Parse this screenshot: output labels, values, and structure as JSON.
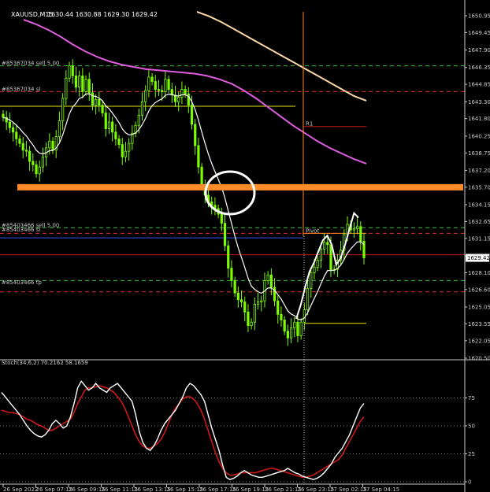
{
  "window": {
    "title": "XAUUSD,M15",
    "ohlc": "1630.44 1630.88 1629.30 1629.42"
  },
  "indicator": {
    "label": "Stoch(34,6,2) 70.2162 58.1659"
  },
  "colors": {
    "background": "#000000",
    "bull": "#7cfc00",
    "bear": "#7cfc00",
    "ma_fast": "#ffffff",
    "ma_slow": "#e05ce0",
    "ma_long": "#ffd8a8",
    "support": "#ff8c28",
    "stoch_main": "#ffffff",
    "stoch_signal": "#d01818"
  },
  "chart_data": {
    "type": "candlestick",
    "symbol": "XAUUSD",
    "timeframe": "M15",
    "y_ticks": [
      "1650.95",
      "1649.45",
      "1647.90",
      "1646.35",
      "1644.85",
      "1643.30",
      "1641.80",
      "1640.25",
      "1638.75",
      "1637.20",
      "1635.70",
      "1634.15",
      "1632.65",
      "1631.15",
      "1629.60",
      "1628.10",
      "1626.60",
      "1625.05",
      "1623.55",
      "1622.05",
      "1620.50"
    ],
    "ylim": [
      1620.5,
      1651.3
    ],
    "x_ticks": [
      "26 Sep 2022",
      "26 Sep 07:15",
      "26 Sep 09:15",
      "26 Sep 11:15",
      "26 Sep 13:15",
      "26 Sep 15:15",
      "26 Sep 17:15",
      "26 Sep 19:15",
      "26 Sep 21:15",
      "26 Sep 23:15",
      "27 Sep 02:15",
      "27 Sep 04:15"
    ],
    "current_price": "1629.42",
    "candles_close": [
      1641.9,
      1641.5,
      1641.0,
      1640.6,
      1640.0,
      1639.6,
      1639.0,
      1638.9,
      1638.0,
      1637.7,
      1636.9,
      1637.5,
      1638.4,
      1639.2,
      1639.8,
      1639.0,
      1640.2,
      1641.6,
      1643.6,
      1645.4,
      1646.5,
      1645.6,
      1644.6,
      1645.6,
      1644.2,
      1645.3,
      1644.1,
      1643.0,
      1643.5,
      1643.0,
      1642.3,
      1640.9,
      1641.5,
      1640.6,
      1640.0,
      1639.5,
      1638.4,
      1638.9,
      1639.6,
      1640.5,
      1641.2,
      1642.1,
      1643.3,
      1644.3,
      1645.5,
      1645.1,
      1644.4,
      1644.3,
      1644.2,
      1645.3,
      1644.4,
      1643.9,
      1643.3,
      1643.7,
      1644.4,
      1644.0,
      1643.0,
      1641.3,
      1639.4,
      1637.5,
      1635.8,
      1635.0,
      1634.4,
      1634.1,
      1633.8,
      1633.3,
      1632.5,
      1630.5,
      1628.5,
      1627.4,
      1626.3,
      1625.7,
      1625.5,
      1624.6,
      1623.4,
      1623.7,
      1625.3,
      1625.5,
      1625.6,
      1627.4,
      1627.9,
      1626.8,
      1625.6,
      1624.4,
      1623.9,
      1622.9,
      1622.3,
      1623.2,
      1623.7,
      1622.5,
      1623.7,
      1624.8,
      1626.7,
      1628.1,
      1628.6,
      1629.2,
      1630.2,
      1630.8,
      1630.6,
      1628.3,
      1628.4,
      1629.2,
      1630.1,
      1631.5,
      1632.4,
      1631.9,
      1632.0,
      1632.2,
      1630.9,
      1629.42
    ],
    "lines": {
      "sell_5_upper": {
        "label": "#85367034 sell 5.00",
        "price": 1646.5
      },
      "sl_upper": {
        "label": "#85367034 sl",
        "price": 1644.2
      },
      "yellow_1": {
        "price": 1642.9
      },
      "support_zone": {
        "price": 1635.7
      },
      "sell_5_lower": {
        "label": "#85403466 sell 5.00",
        "price": 1632.1
      },
      "sl_lower": {
        "label": "#85403466 sl",
        "price": 1631.6
      },
      "blue_h": {
        "price": 1631.2
      },
      "red_h": {
        "price": 1629.7
      },
      "green_tp": {
        "price": 1627.4
      },
      "tp_lower": {
        "label": "#85403466 tp",
        "price": 1626.4
      },
      "yellow_2": {
        "price": 1623.6
      },
      "pivot_label": "Pivot",
      "r1_label": "R1"
    },
    "stochastic": {
      "y_ticks": [
        "75",
        "50",
        "25",
        "0"
      ],
      "ylim": [
        0,
        100
      ],
      "main": [
        80,
        76,
        72,
        68,
        64,
        60,
        55,
        50,
        46,
        43,
        41,
        40,
        42,
        46,
        52,
        55,
        52,
        48,
        50,
        58,
        70,
        84,
        90,
        86,
        82,
        84,
        88,
        84,
        82,
        80,
        84,
        86,
        88,
        84,
        80,
        76,
        72,
        60,
        45,
        35,
        30,
        28,
        32,
        38,
        46,
        52,
        56,
        60,
        64,
        70,
        76,
        84,
        88,
        86,
        82,
        78,
        72,
        60,
        48,
        38,
        28,
        15,
        4,
        2,
        3,
        5,
        8,
        10,
        8,
        6,
        5,
        4,
        4,
        5,
        6,
        7,
        8,
        9,
        10,
        12,
        10,
        8,
        7,
        5,
        4,
        3,
        2,
        3,
        5,
        8,
        12,
        16,
        22,
        26,
        30,
        36,
        42,
        50,
        58,
        66,
        70
      ],
      "signal": [
        64,
        63,
        62,
        62,
        61,
        60,
        58,
        56,
        55,
        53,
        51,
        50,
        48,
        46,
        46,
        48,
        50,
        52,
        54,
        56,
        62,
        70,
        76,
        82,
        84,
        84,
        85,
        86,
        85,
        84,
        82,
        80,
        76,
        72,
        66,
        58,
        50,
        42,
        36,
        32,
        30,
        30,
        32,
        34,
        38,
        44,
        52,
        60,
        66,
        70,
        74,
        76,
        76,
        74,
        70,
        64,
        56,
        46,
        36,
        26,
        18,
        12,
        8,
        6,
        6,
        7,
        8,
        8,
        8,
        8,
        8,
        9,
        10,
        11,
        12,
        12,
        11,
        10,
        9,
        8,
        7,
        6,
        5,
        4,
        4,
        5,
        6,
        8,
        10,
        12,
        14,
        16,
        18,
        20,
        24,
        30,
        36,
        42,
        48,
        54,
        58
      ]
    }
  }
}
